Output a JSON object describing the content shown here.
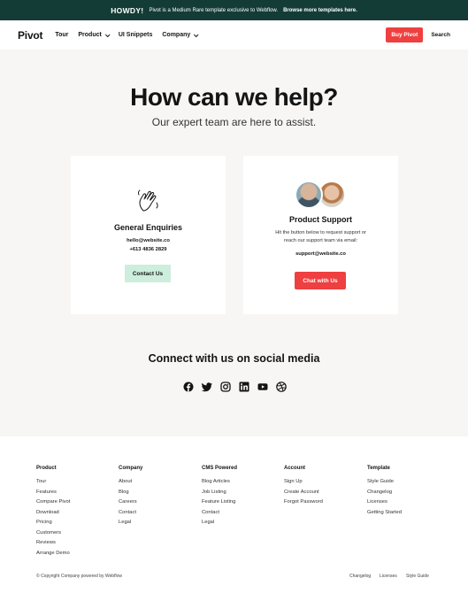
{
  "announcement": {
    "howdy": "HOWDY!",
    "text": "Pivot is a Medium Rare template exclusive to Webflow.",
    "link": "Browse more templates here."
  },
  "nav": {
    "logo": "Pivot",
    "items": [
      {
        "label": "Tour",
        "dropdown": false
      },
      {
        "label": "Product",
        "dropdown": true
      },
      {
        "label": "UI Snippets",
        "dropdown": false
      },
      {
        "label": "Company",
        "dropdown": true
      }
    ],
    "buy_label": "Buy Pivot",
    "search_label": "Search"
  },
  "hero": {
    "title": "How can we help?",
    "subtitle": "Our expert team are here to assist."
  },
  "general": {
    "title": "General Enquiries",
    "email": "hello@website.co",
    "phone": "+613 4836 2829",
    "button": "Contact Us"
  },
  "support": {
    "title": "Product Support",
    "description": "Hit the button below to request support or reach our support team via email:",
    "email": "support@website.co",
    "button": "Chat with Us"
  },
  "social": {
    "title": "Connect with us on social media",
    "icons": [
      "facebook-icon",
      "twitter-icon",
      "instagram-icon",
      "linkedin-icon",
      "youtube-icon",
      "dribbble-icon"
    ]
  },
  "footer": {
    "columns": [
      {
        "title": "Product",
        "links": [
          "Tour",
          "Features",
          "Compare Pivot",
          "Download",
          "Pricing",
          "Customers",
          "Reviews",
          "Arrange Demo"
        ]
      },
      {
        "title": "Company",
        "links": [
          "About",
          "Blog",
          "Careers",
          "Contact",
          "Legal"
        ]
      },
      {
        "title": "CMS Powered",
        "links": [
          "Blog Articles",
          "Job Listing",
          "Feature Listing",
          "Contact",
          "Legal"
        ]
      },
      {
        "title": "Account",
        "links": [
          "Sign Up",
          "Create Account",
          "Forgot Password"
        ]
      },
      {
        "title": "Template",
        "links": [
          "Style Guide",
          "Changelog",
          "Licenses",
          "Getting Started"
        ]
      }
    ],
    "copyright": "© Copyright Company powered by Webflow",
    "legal": [
      "Changelog",
      "Licenses",
      "Style Guide"
    ]
  },
  "colors": {
    "announcement_bg": "#143c37",
    "accent_red": "#ee4040",
    "mint": "#cdeedd",
    "page_bg": "#f7f6f4"
  }
}
